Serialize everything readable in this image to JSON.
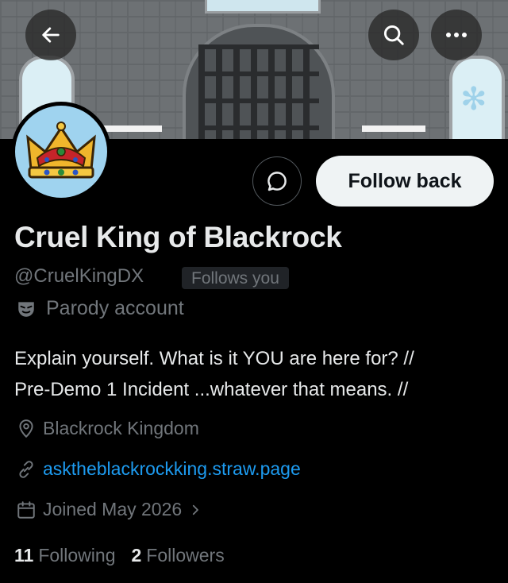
{
  "profile": {
    "display_name": "Cruel King of Blackrock",
    "handle": "@CruelKingDX",
    "follows_you_badge": "Follows you",
    "parody_label": "Parody account",
    "bio_line1": "Explain yourself. What is it YOU are here for? //",
    "bio_line2": "Pre-Demo 1 Incident ...whatever that means. //",
    "location": "Blackrock Kingdom",
    "website": "asktheblackrockking.straw.page",
    "joined": "Joined May 2026",
    "following_count": "11",
    "following_label": "Following",
    "followers_count": "2",
    "followers_label": "Followers"
  },
  "actions": {
    "follow_back_label": "Follow back"
  },
  "icons": {
    "back": "back-arrow-icon",
    "search": "search-icon",
    "more": "more-dots-icon",
    "message": "message-icon",
    "parody": "mask-icon",
    "location": "location-pin-icon",
    "link": "link-icon",
    "calendar": "calendar-icon",
    "chevron": "chevron-right-icon"
  },
  "colors": {
    "background": "#000000",
    "primary_text": "#e7e9ea",
    "secondary_text": "#71767b",
    "link": "#1d9bf0",
    "follow_button_bg": "#eff3f4"
  }
}
